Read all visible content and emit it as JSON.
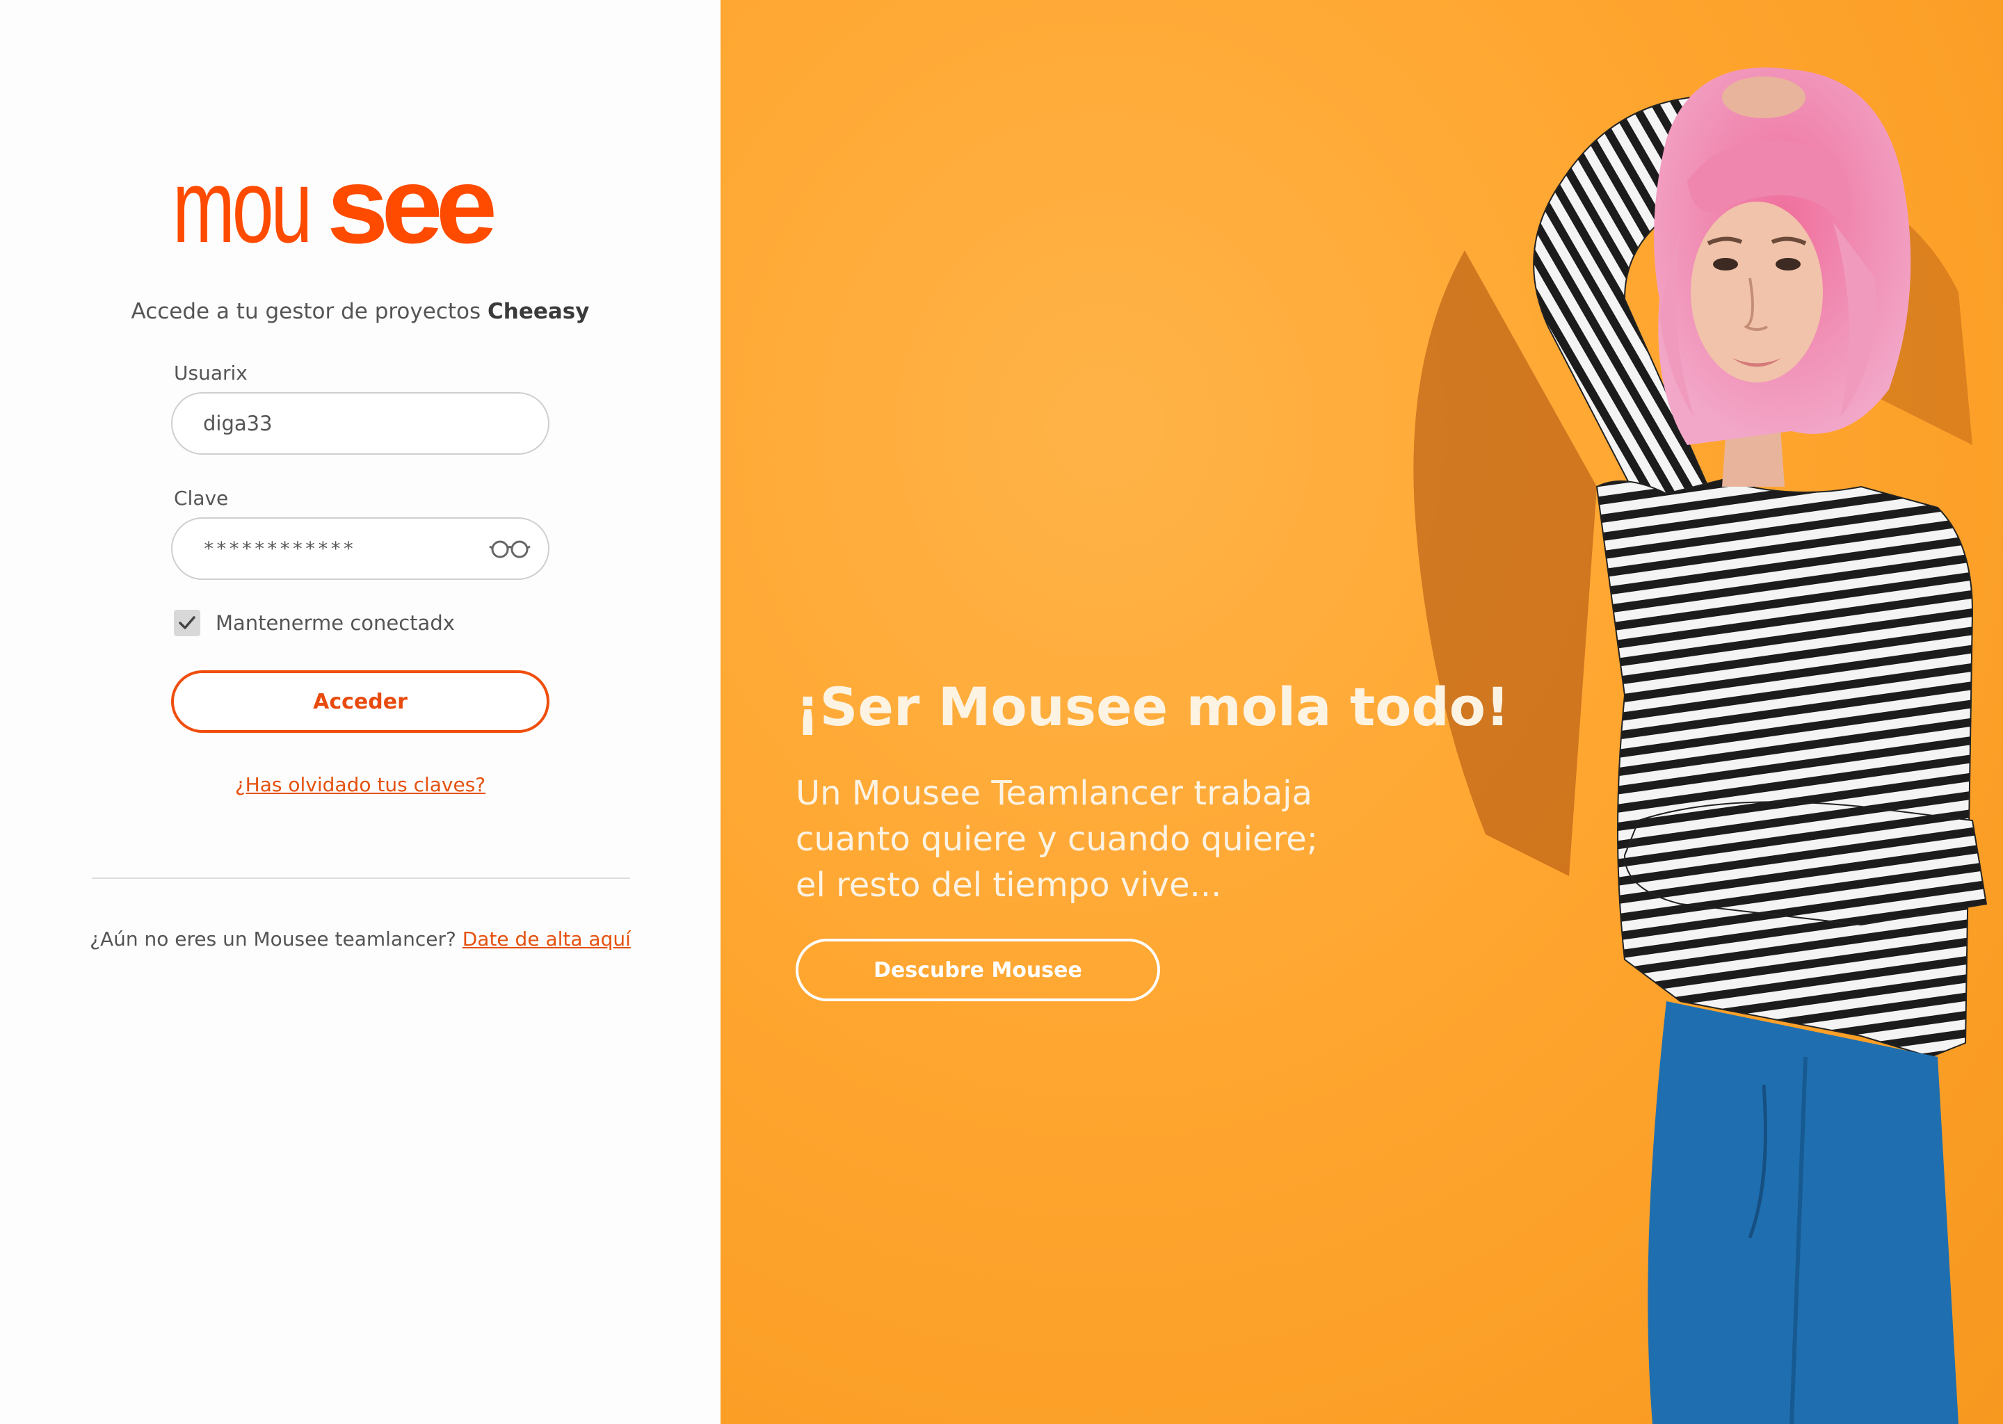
{
  "brand": {
    "logo_thin": "mou",
    "logo_bold": "see",
    "accent": "#ff4b00"
  },
  "login": {
    "subtitle_prefix": "Accede a tu gestor de proyectos ",
    "subtitle_brand": "Cheeasy",
    "username_label": "Usuarix",
    "username_value": "diga33",
    "password_label": "Clave",
    "password_value": "************",
    "remember_label": "Mantenerme conectadx",
    "remember_checked": true,
    "submit_label": "Acceder",
    "forgot_label": "¿Has olvidado tus claves?",
    "signup_prefix": "¿Aún no eres un Mousee teamlancer? ",
    "signup_link": "Date de alta aquí"
  },
  "hero": {
    "title": "¡Ser Mousee mola todo!",
    "text": "Un Mousee Teamlancer trabaja cuanto quiere y cuando quiere; el resto del tiempo vive...",
    "button_label": "Descubre Mousee",
    "background": "#ffa630"
  }
}
